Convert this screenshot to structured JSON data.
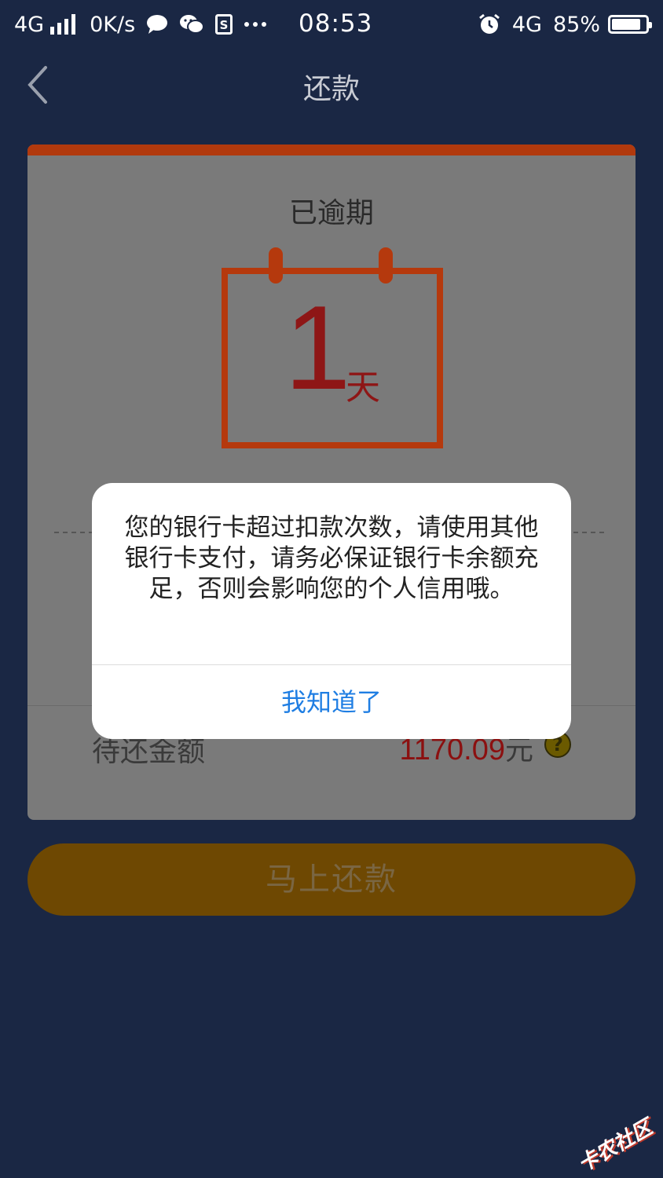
{
  "status_bar": {
    "network": "4G",
    "speed": "0K/s",
    "icons": [
      "chat-bubble-icon",
      "wechat-icon",
      "sim-icon",
      "more-dots-icon",
      "alarm-icon"
    ],
    "time": "08:53",
    "mobile_data": "4G",
    "battery_percent": "85%",
    "battery_level": 0.85
  },
  "nav": {
    "back_icon": "chevron-left-icon",
    "title": "还款"
  },
  "card": {
    "status_label": "已逾期",
    "days_number": "1",
    "days_unit": "天",
    "due_label": "待还金额",
    "due_amount": "1170.09",
    "due_currency": "元",
    "help_glyph": "?",
    "accent_color": "#b5390d"
  },
  "pay_button": {
    "label": "马上还款"
  },
  "modal": {
    "message": "您的银行卡超过扣款次数，请使用其他银行卡支付，请务必保证银行卡余额充足，否则会影响您的个人信用哦。",
    "confirm_label": "我知道了",
    "confirm_color": "#1f7ee3"
  },
  "watermark": {
    "text": "卡农社区"
  }
}
